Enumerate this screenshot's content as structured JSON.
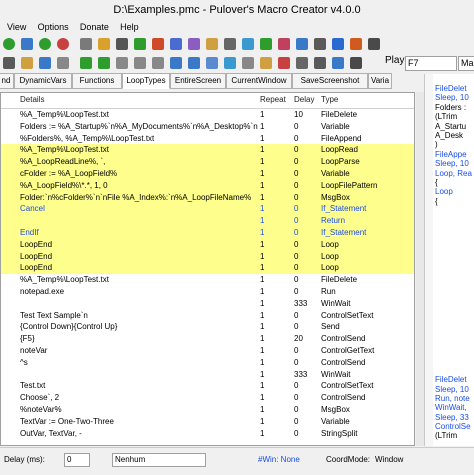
{
  "title": "D:\\Examples.pmc - Pulover's Macro Creator v4.0.0",
  "menu": [
    "View",
    "Options",
    "Donate",
    "Help"
  ],
  "row2_label": "Play",
  "hotkey": "F7",
  "mode": "Manual",
  "tabs": [
    "nd",
    "DynamicVars",
    "Functions",
    "LoopTypes",
    "EntireScreen",
    "CurrentWindow",
    "SaveScreenshot",
    "Varia"
  ],
  "columns": {
    "details": "Details",
    "repeat": "Repeat",
    "delay": "Delay",
    "type": "Type"
  },
  "rows": [
    {
      "d": "%A_Temp%\\LoopTest.txt",
      "r": "1",
      "dl": "10",
      "t": "FileDelete",
      "y": false,
      "b": false
    },
    {
      "d": "Folders := %A_Startup%`n%A_MyDocuments%`n%A_Desktop%`n%A_Pr",
      "r": "1",
      "dl": "0",
      "t": "Variable",
      "y": false,
      "b": false
    },
    {
      "d": "%Folders%, %A_Temp%\\LoopTest.txt",
      "r": "1",
      "dl": "0",
      "t": "FileAppend",
      "y": false,
      "b": false
    },
    {
      "d": "%A_Temp%\\LoopTest.txt",
      "r": "1",
      "dl": "0",
      "t": "LoopRead",
      "y": true,
      "b": false
    },
    {
      "d": "%A_LoopReadLine%, `,",
      "r": "1",
      "dl": "0",
      "t": "LoopParse",
      "y": true,
      "b": false
    },
    {
      "d": "cFolder := %A_LoopField%",
      "r": "1",
      "dl": "0",
      "t": "Variable",
      "y": true,
      "b": false
    },
    {
      "d": "%A_LoopField%\\*.*, 1, 0",
      "r": "1",
      "dl": "0",
      "t": "LoopFilePattern",
      "y": true,
      "b": false
    },
    {
      "d": "Folder:`n%cFolder%`n`nFile %A_Index%:`n%A_LoopFileName%",
      "r": "1",
      "dl": "0",
      "t": "MsgBox",
      "y": true,
      "b": false
    },
    {
      "d": "Cancel",
      "r": "1",
      "dl": "0",
      "t": "If_Statement",
      "y": true,
      "b": true
    },
    {
      "d": "",
      "r": "1",
      "dl": "0",
      "t": "Return",
      "y": true,
      "b": true
    },
    {
      "d": "EndIf",
      "r": "1",
      "dl": "0",
      "t": "If_Statement",
      "y": true,
      "b": true
    },
    {
      "d": "LoopEnd",
      "r": "1",
      "dl": "0",
      "t": "Loop",
      "y": true,
      "b": false
    },
    {
      "d": "LoopEnd",
      "r": "1",
      "dl": "0",
      "t": "Loop",
      "y": true,
      "b": false
    },
    {
      "d": "LoopEnd",
      "r": "1",
      "dl": "0",
      "t": "Loop",
      "y": true,
      "b": false
    },
    {
      "d": "%A_Temp%\\LoopTest.txt",
      "r": "1",
      "dl": "0",
      "t": "FileDelete",
      "y": false,
      "b": false
    },
    {
      "d": "notepad.exe",
      "r": "1",
      "dl": "0",
      "t": "Run",
      "y": false,
      "b": false
    },
    {
      "d": "",
      "r": "1",
      "dl": "333",
      "t": "WinWait",
      "y": false,
      "b": false
    },
    {
      "d": "Test Text Sample`n",
      "r": "1",
      "dl": "0",
      "t": "ControlSetText",
      "y": false,
      "b": false
    },
    {
      "d": "{Control Down}{Control Up}",
      "r": "1",
      "dl": "0",
      "t": "Send",
      "y": false,
      "b": false
    },
    {
      "d": "{F5}",
      "r": "1",
      "dl": "20",
      "t": "ControlSend",
      "y": false,
      "b": false
    },
    {
      "d": "noteVar",
      "r": "1",
      "dl": "0",
      "t": "ControlGetText",
      "y": false,
      "b": false
    },
    {
      "d": "^s",
      "r": "1",
      "dl": "0",
      "t": "ControlSend",
      "y": false,
      "b": false
    },
    {
      "d": "",
      "r": "1",
      "dl": "333",
      "t": "WinWait",
      "y": false,
      "b": false
    },
    {
      "d": "Test.txt",
      "r": "1",
      "dl": "0",
      "t": "ControlSetText",
      "y": false,
      "b": false
    },
    {
      "d": "Choose`, 2",
      "r": "1",
      "dl": "0",
      "t": "ControlSend",
      "y": false,
      "b": false
    },
    {
      "d": "%noteVar%",
      "r": "1",
      "dl": "0",
      "t": "MsgBox",
      "y": false,
      "b": false
    },
    {
      "d": "TextVar := One-Two-Three",
      "r": "1",
      "dl": "0",
      "t": "Variable",
      "y": false,
      "b": false
    },
    {
      "d": "OutVar, TextVar, -",
      "r": "1",
      "dl": "0",
      "t": "StringSplit",
      "y": false,
      "b": false
    }
  ],
  "code": [
    {
      "t": "FileDelet",
      "c": "#1a4ee6"
    },
    {
      "t": "Sleep, 10",
      "c": "#1a4ee6"
    },
    {
      "t": "Folders :",
      "c": "#000000"
    },
    {
      "t": "(LTrim",
      "c": "#000000"
    },
    {
      "t": "  A_Startu",
      "c": "#000000"
    },
    {
      "t": "  A_Desk",
      "c": "#000000"
    },
    {
      "t": ")",
      "c": "#000000"
    },
    {
      "t": "FileAppe",
      "c": "#1a4ee6"
    },
    {
      "t": "Sleep, 10",
      "c": "#1a4ee6"
    },
    {
      "t": "Loop, Rea",
      "c": "#1a4ee6"
    },
    {
      "t": "{",
      "c": "#000000"
    },
    {
      "t": "   Loop",
      "c": "#1a4ee6"
    },
    {
      "t": "   {",
      "c": "#000000"
    },
    {
      "t": "",
      "c": "#000000"
    },
    {
      "t": "",
      "c": "#000000"
    },
    {
      "t": "",
      "c": "#000000"
    },
    {
      "t": "",
      "c": "#000000"
    },
    {
      "t": "",
      "c": "#000000"
    },
    {
      "t": "",
      "c": "#000000"
    },
    {
      "t": "",
      "c": "#000000"
    },
    {
      "t": "",
      "c": "#000000"
    },
    {
      "t": "",
      "c": "#000000"
    },
    {
      "t": "",
      "c": "#000000"
    },
    {
      "t": "",
      "c": "#000000"
    },
    {
      "t": "",
      "c": "#000000"
    },
    {
      "t": "",
      "c": "#000000"
    },
    {
      "t": "",
      "c": "#000000"
    },
    {
      "t": "",
      "c": "#000000"
    },
    {
      "t": "",
      "c": "#000000"
    },
    {
      "t": "",
      "c": "#000000"
    },
    {
      "t": "",
      "c": "#000000"
    },
    {
      "t": "FileDelet",
      "c": "#1a4ee6"
    },
    {
      "t": "Sleep, 10",
      "c": "#1a4ee6"
    },
    {
      "t": "Run, note",
      "c": "#1a4ee6"
    },
    {
      "t": "WinWait,",
      "c": "#1a4ee6"
    },
    {
      "t": "Sleep, 33",
      "c": "#1a4ee6"
    },
    {
      "t": "ControlSe",
      "c": "#1a4ee6"
    },
    {
      "t": "(LTrim",
      "c": "#000000"
    }
  ],
  "status": {
    "label": "Delay (ms):",
    "delay": "0",
    "combo": "Nenhum",
    "win": "#Win: None",
    "coord_label": "CoordMode:",
    "coord": "Window"
  },
  "colors": {
    "highlight": "#fefe8c",
    "blue_text": "#1a4ee6"
  }
}
